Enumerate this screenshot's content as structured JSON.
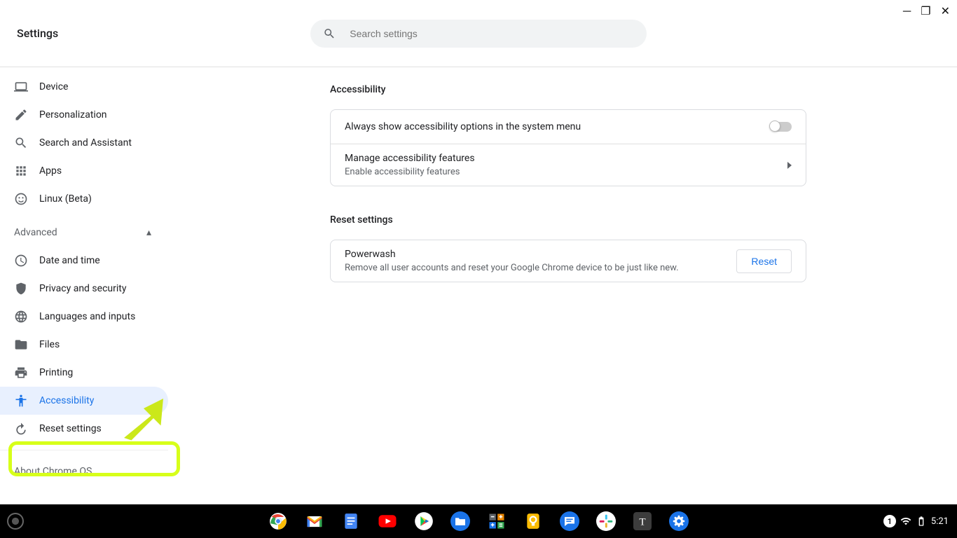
{
  "window": {
    "minimize_title": "Minimize",
    "maximize_title": "Maximize",
    "close_title": "Close"
  },
  "header": {
    "title": "Settings"
  },
  "search": {
    "placeholder": "Search settings"
  },
  "sidebar": {
    "items_top": [
      {
        "id": "device",
        "label": "Device"
      },
      {
        "id": "personalization",
        "label": "Personalization"
      },
      {
        "id": "search-assistant",
        "label": "Search and Assistant"
      },
      {
        "id": "apps",
        "label": "Apps"
      },
      {
        "id": "linux",
        "label": "Linux (Beta)"
      }
    ],
    "advanced_label": "Advanced",
    "items_advanced": [
      {
        "id": "date-time",
        "label": "Date and time"
      },
      {
        "id": "privacy",
        "label": "Privacy and security"
      },
      {
        "id": "languages",
        "label": "Languages and inputs"
      },
      {
        "id": "files",
        "label": "Files"
      },
      {
        "id": "printing",
        "label": "Printing"
      },
      {
        "id": "accessibility",
        "label": "Accessibility",
        "selected": true
      },
      {
        "id": "reset",
        "label": "Reset settings"
      }
    ],
    "about_label": "About Chrome OS"
  },
  "content": {
    "accessibility": {
      "section_title": "Accessibility",
      "row_always_show": "Always show accessibility options in the system menu",
      "row_manage_title": "Manage accessibility features",
      "row_manage_sub": "Enable accessibility features"
    },
    "reset": {
      "section_title": "Reset settings",
      "row_title": "Powerwash",
      "row_sub": "Remove all user accounts and reset your Google Chrome device to be just like new.",
      "button": "Reset"
    }
  },
  "shelf": {
    "apps": [
      {
        "id": "chrome",
        "name": "Chrome",
        "bg": "#fff"
      },
      {
        "id": "gmail",
        "name": "Gmail",
        "bg": "#fff"
      },
      {
        "id": "docs",
        "name": "Docs",
        "bg": "#4285f4"
      },
      {
        "id": "youtube",
        "name": "YouTube",
        "bg": "#ff0000"
      },
      {
        "id": "play",
        "name": "Play Store",
        "bg": "#fff"
      },
      {
        "id": "files",
        "name": "Files",
        "bg": "#1a73e8"
      },
      {
        "id": "calculator",
        "name": "Calculator",
        "bg": "#34a853"
      },
      {
        "id": "keep",
        "name": "Keep",
        "bg": "#fbbc04"
      },
      {
        "id": "messages",
        "name": "Messages",
        "bg": "#1a73e8"
      },
      {
        "id": "slack",
        "name": "Slack",
        "bg": "#fff"
      },
      {
        "id": "text",
        "name": "Text",
        "bg": "#3c3c3c"
      },
      {
        "id": "settings",
        "name": "Settings",
        "bg": "#1a73e8",
        "active": true
      }
    ],
    "status": {
      "notif_count": "1",
      "time": "5:21"
    }
  }
}
